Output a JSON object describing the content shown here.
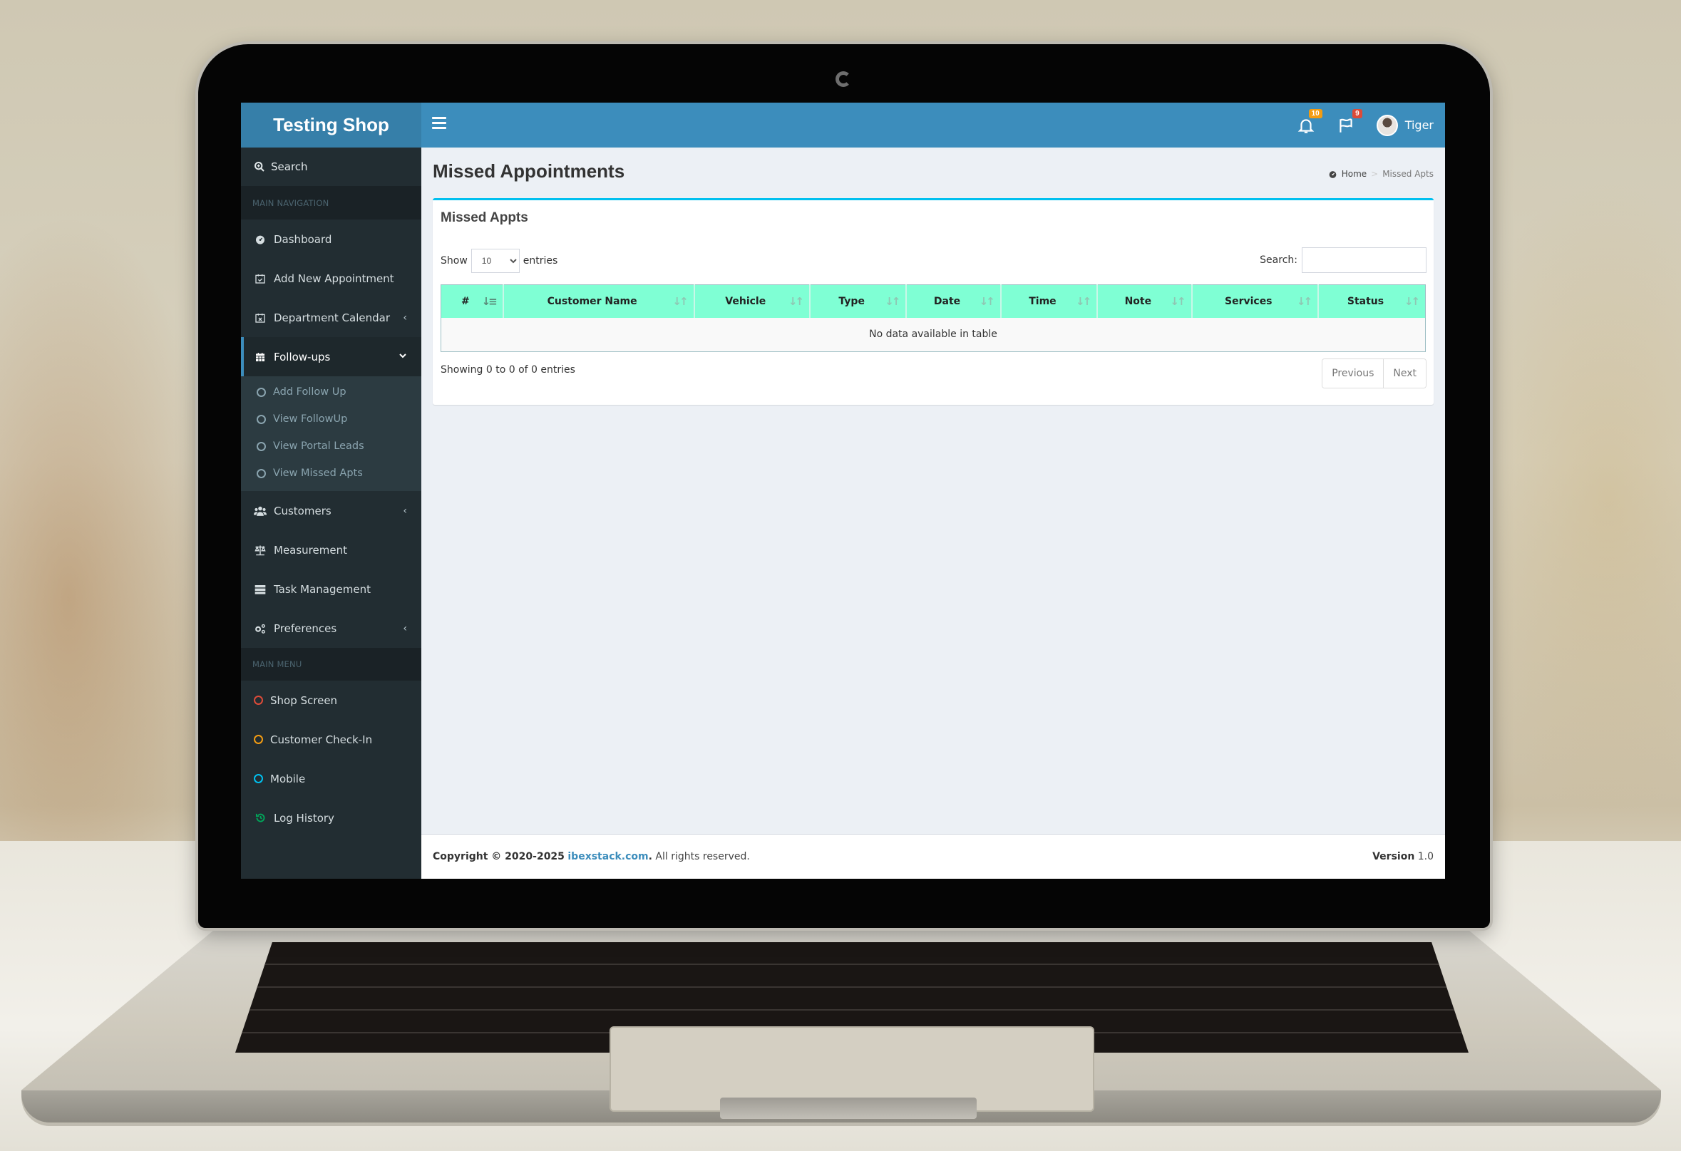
{
  "app": {
    "brand": "Testing Shop",
    "colors": {
      "header": "#3c8dbc",
      "logo_bg": "#367fa9",
      "sidebar_bg": "#222d32",
      "table_header": "#7fffd4",
      "box_accent": "#00c0ef"
    }
  },
  "header": {
    "menu_icon": "hamburger-icon",
    "notifications": {
      "icon": "bell-icon",
      "count": "10"
    },
    "flags": {
      "icon": "flag-icon",
      "count": "9"
    },
    "user": {
      "name": "Tiger",
      "icon": "avatar"
    }
  },
  "sidebar": {
    "search_label": "Search",
    "section_main_navigation": "MAIN NAVIGATION",
    "items": [
      {
        "label": "Dashboard",
        "icon": "dashboard-icon"
      },
      {
        "label": "Add New Appointment",
        "icon": "calendar-check-icon"
      },
      {
        "label": "Department Calendar",
        "icon": "calendar-x-icon",
        "chevron": "‹"
      },
      {
        "label": "Follow-ups",
        "icon": "calendar-icon",
        "chevron": "⌄",
        "active": true
      }
    ],
    "followups_subitems": [
      {
        "label": "Add Follow Up"
      },
      {
        "label": "View FollowUp"
      },
      {
        "label": "View Portal Leads"
      },
      {
        "label": "View Missed Apts"
      }
    ],
    "items2": [
      {
        "label": "Customers",
        "icon": "users-icon",
        "chevron": "‹"
      },
      {
        "label": "Measurement",
        "icon": "balance-scale-icon"
      },
      {
        "label": "Task Management",
        "icon": "server-icon"
      },
      {
        "label": "Preferences",
        "icon": "cogs-icon",
        "chevron": "‹"
      }
    ],
    "section_main_menu": "MAIN MENU",
    "menu_items": [
      {
        "label": "Shop Screen",
        "icon": "circle-icon",
        "color": "#dd4b39"
      },
      {
        "label": "Customer Check-In",
        "icon": "circle-icon",
        "color": "#f39c12"
      },
      {
        "label": "Mobile",
        "icon": "circle-icon",
        "color": "#00c0ef"
      },
      {
        "label": "Log History",
        "icon": "history-icon",
        "color": "#00a65a"
      }
    ]
  },
  "page": {
    "title": "Missed Appointments",
    "breadcrumb": {
      "home": "Home",
      "separator": ">",
      "current": "Missed Apts"
    }
  },
  "box": {
    "title": "Missed Appts",
    "length": {
      "show": "Show",
      "value": "10",
      "entries": "entries"
    },
    "search": {
      "label": "Search:",
      "value": "",
      "placeholder": ""
    },
    "columns": [
      "#",
      "Customer Name",
      "Vehicle",
      "Type",
      "Date",
      "Time",
      "Note",
      "Services",
      "Status"
    ],
    "empty_message": "No data available in table",
    "info": "Showing 0 to 0 of 0 entries",
    "pagination": {
      "previous": "Previous",
      "next": "Next"
    }
  },
  "footer": {
    "copyright": "Copyright © 2020-2025",
    "link": "ibexstack.com",
    "rights": ". All rights reserved.",
    "version_label": "Version",
    "version": "1.0"
  }
}
